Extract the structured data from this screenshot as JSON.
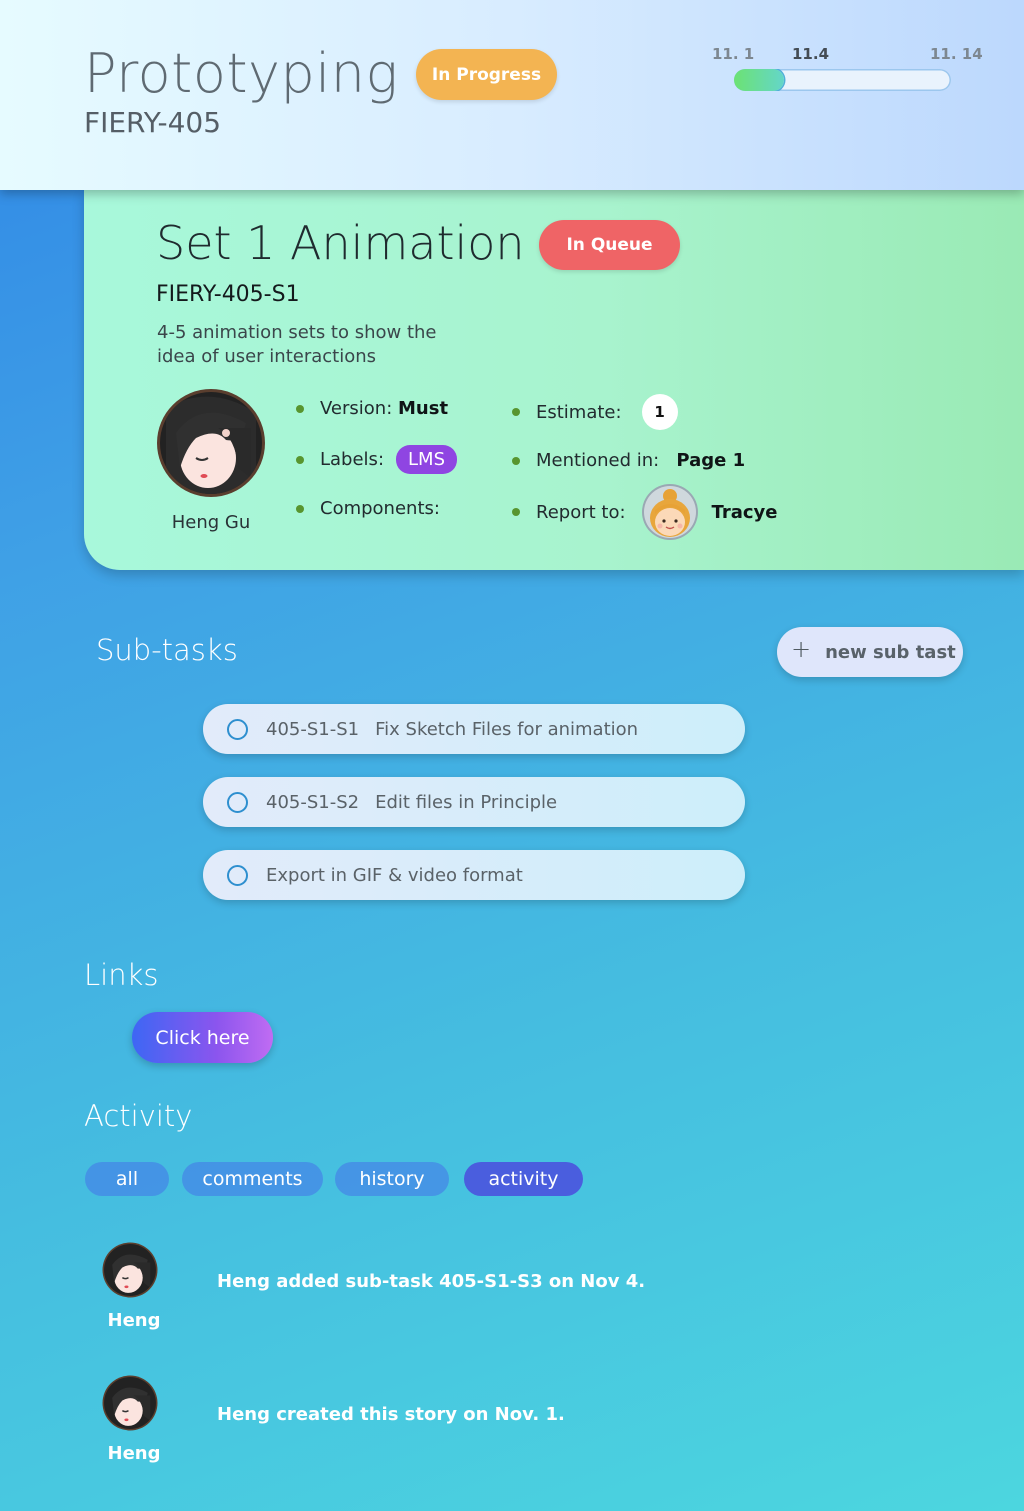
{
  "header": {
    "project_title": "Prototyping",
    "project_key": "FIERY-405",
    "status": "In Progress",
    "status_color": "#f3b452",
    "timeline": {
      "start_label": "11. 1",
      "current_label": "11.4",
      "end_label": "11. 14",
      "progress_fraction": 0.23
    }
  },
  "story": {
    "title": "Set 1 Animation",
    "status": "In Queue",
    "status_color": "#ef6466",
    "key": "FIERY-405-S1",
    "description": "4-5 animation sets to show the idea of user interactions",
    "assignee": {
      "name": "Heng Gu",
      "icon": "avatar-woman-dark-hair-icon"
    },
    "fields": {
      "version_label": "Version:",
      "version_value": "Must",
      "labels_label": "Labels:",
      "labels_value": "LMS",
      "components_label": "Components:",
      "estimate_label": "Estimate:",
      "estimate_value": "1",
      "mentioned_label": "Mentioned in:",
      "mentioned_value": "Page 1",
      "report_label": "Report to:",
      "report_value": "Tracye",
      "reporter_icon": "avatar-child-blonde-icon"
    }
  },
  "subtasks": {
    "title": "Sub-tasks",
    "new_button_label": "new sub tast",
    "items": [
      {
        "key": "405-S1-S1",
        "text": "Fix Sketch Files for animation"
      },
      {
        "key": "405-S1-S2",
        "text": "Edit files in Principle"
      },
      {
        "key": "",
        "text": "Export in GIF & video format"
      }
    ]
  },
  "links": {
    "title": "Links",
    "button_label": "Click here"
  },
  "activity": {
    "title": "Activity",
    "tabs": [
      "all",
      "comments",
      "history",
      "activity"
    ],
    "active_tab": "activity",
    "entries": [
      {
        "user": "Heng",
        "text": "Heng added sub-task 405-S1-S3 on Nov 4."
      },
      {
        "user": "Heng",
        "text": "Heng created this story on Nov. 1."
      }
    ]
  }
}
